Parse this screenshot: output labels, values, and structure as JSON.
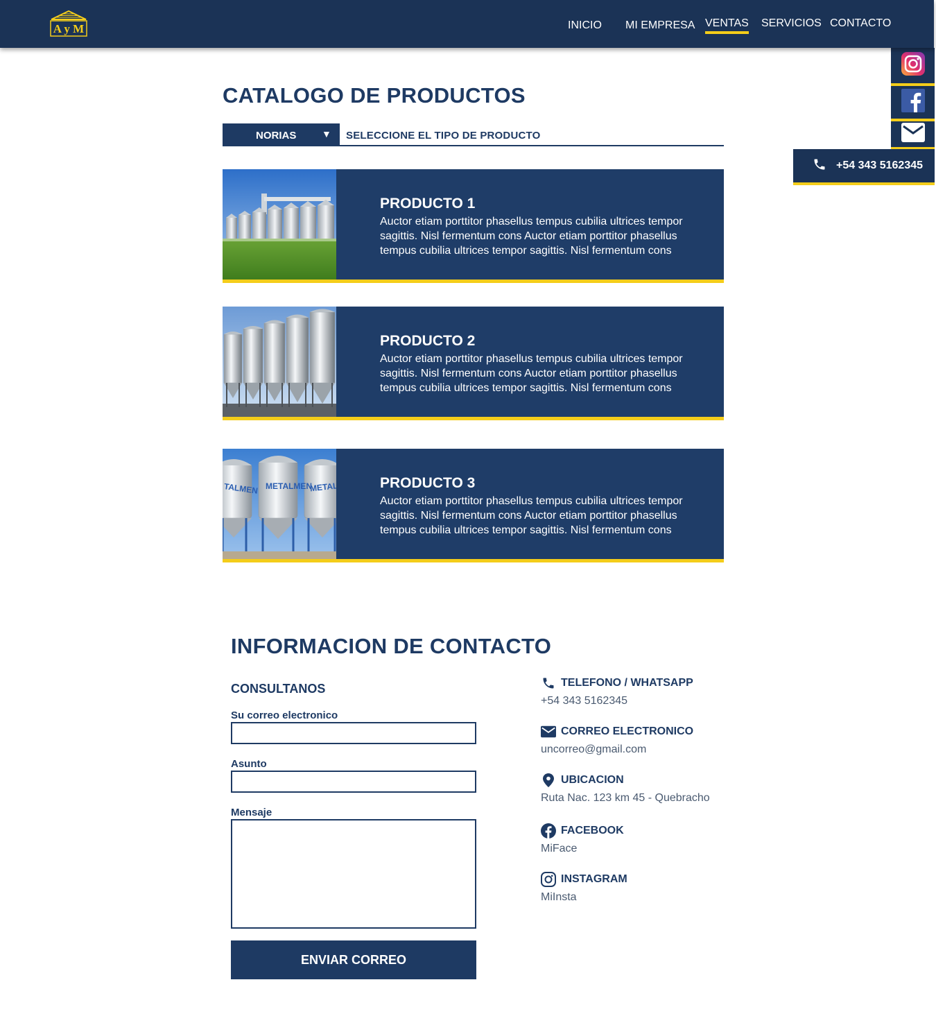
{
  "header": {
    "logo_text": "AyM",
    "nav": [
      {
        "label": "INICIO"
      },
      {
        "label": "MI EMPRESA"
      },
      {
        "label": "VENTAS"
      },
      {
        "label": "SERVICIOS"
      },
      {
        "label": "CONTACTO"
      }
    ],
    "active_nav": "VENTAS"
  },
  "sidebar": {
    "social": [
      {
        "name": "instagram-icon"
      },
      {
        "name": "facebook-icon"
      },
      {
        "name": "mail-icon"
      }
    ],
    "phone": "+54 343 5162345"
  },
  "catalog": {
    "title": "CATALOGO DE PRODUCTOS",
    "select_value": "NORIAS",
    "select_arrow": "▼",
    "select_hint": "SELECCIONE EL TIPO DE PRODUCTO",
    "products": [
      {
        "title": "PRODUCTO 1",
        "description": "Auctor etiam porttitor phasellus tempus cubilia ultrices tempor sagittis. Nisl fermentum cons Auctor etiam porttitor phasellus tempus cubilia ultrices tempor sagittis. Nisl fermentum cons"
      },
      {
        "title": "PRODUCTO 2",
        "description": "Auctor etiam porttitor phasellus tempus cubilia ultrices tempor sagittis. Nisl fermentum cons Auctor etiam porttitor phasellus tempus cubilia ultrices tempor sagittis. Nisl fermentum cons"
      },
      {
        "title": "PRODUCTO 3",
        "description": "Auctor etiam porttitor phasellus tempus cubilia ultrices tempor sagittis. Nisl fermentum cons Auctor etiam porttitor phasellus tempus cubilia ultrices tempor sagittis. Nisl fermentum cons"
      }
    ]
  },
  "contact": {
    "title": "INFORMACION DE CONTACTO",
    "form": {
      "heading": "CONSULTANOS",
      "email_label": "Su correo electronico",
      "subject_label": "Asunto",
      "message_label": "Mensaje",
      "submit_label": "ENVIAR CORREO"
    },
    "info": [
      {
        "icon": "phone-icon",
        "label": "TELEFONO / WHATSAPP",
        "value": "+54 343 5162345"
      },
      {
        "icon": "mail-icon",
        "label": "CORREO ELECTRONICO",
        "value": "uncorreo@gmail.com"
      },
      {
        "icon": "location-pin-icon",
        "label": "UBICACION",
        "value": "Ruta Nac. 123 km 45 - Quebracho"
      },
      {
        "icon": "facebook-icon",
        "label": "FACEBOOK",
        "value": "MiFace"
      },
      {
        "icon": "instagram-icon",
        "label": "INSTAGRAM",
        "value": "MiInsta"
      }
    ]
  },
  "colors": {
    "navy": "#1b3356",
    "panel": "#1f3d68",
    "accent": "#f4cd1a",
    "text": "#1e3a63"
  }
}
